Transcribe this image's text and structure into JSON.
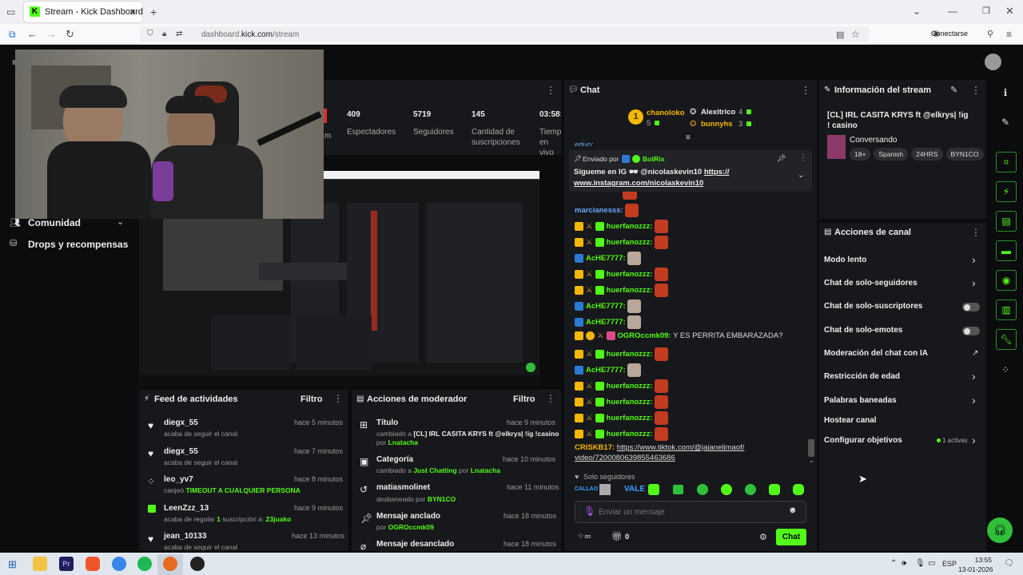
{
  "browser": {
    "tab_title": "Stream - Kick Dashboard",
    "url_prefix": "dashboard.",
    "url_domain": "kick.com",
    "url_path": "/stream",
    "connect_label": "Conectarse"
  },
  "nav": {
    "comunidad": "Comunidad",
    "drops": "Drops y recompensas"
  },
  "stats": [
    {
      "value": "409",
      "label": "Espectadores"
    },
    {
      "value": "5719",
      "label": "Seguidores"
    },
    {
      "value": "145",
      "label": "Cantidad de suscripciones"
    },
    {
      "value": "03:58:",
      "label": "Tiempo en vivo"
    }
  ],
  "stats_partial_label": "m",
  "activity": {
    "title": "Feed de actividades",
    "filter": "Filtro",
    "items": [
      {
        "name": "diegx_55",
        "time": "hace 5 minutos",
        "sub": "acaba de seguir el canal"
      },
      {
        "name": "diegx_55",
        "time": "hace 7 minutos",
        "sub": "acaba de seguir el canal"
      },
      {
        "name": "leo_yv7",
        "time": "hace 8 minutos",
        "sub": "canjeó",
        "highlight": "TIMEOUT A CUALQUIER PERSONA"
      },
      {
        "name": "LeenZzz_13",
        "time": "hace 9 minutos",
        "sub": "acaba de regalar",
        "count": "1",
        "sub2": "suscripción a:",
        "target": "23juako"
      },
      {
        "name": "jean_10133",
        "time": "hace 13 minutos",
        "sub": "acaba de seguir el canal"
      }
    ]
  },
  "mod": {
    "title": "Acciones de moderador",
    "filter": "Filtro",
    "items": [
      {
        "name": "Título",
        "time": "hace 9 minutos",
        "sub": "cambiado a",
        "value": "[CL] IRL CASITA KRYS ft @elkrys| !ig !casino",
        "by": "por",
        "user": "Lnatacha"
      },
      {
        "name": "Categoría",
        "time": "hace 10 minutos",
        "sub": "cambiado a",
        "value": "Just Chatting",
        "by": "por",
        "user": "Lnatacha"
      },
      {
        "name": "matiasmolinet",
        "time": "hace 11 minutos",
        "sub": "desbaneado por",
        "user": "BYN1CO"
      },
      {
        "name": "Mensaje anclado",
        "time": "hace 18 minutos",
        "sub": "por",
        "user": "OGROccmk09"
      },
      {
        "name": "Mensaje desanclado",
        "time": "hace 18 minutos"
      }
    ]
  },
  "chat": {
    "title": "Chat",
    "leaders": [
      {
        "name": "chanoloko",
        "count": "5"
      },
      {
        "name": "Alexitrico",
        "count": "4"
      },
      {
        "name": "bunnyhs",
        "count": "3"
      }
    ],
    "pinned": {
      "sent_by": "Enviado por",
      "author": "BotRix",
      "text": "Sígueme en IG",
      "handle": "@nicolaskevin10",
      "link1": "https://",
      "link2": "www.instagram.com/nicolaskevin10"
    },
    "partial_top": "eduo:",
    "messages": [
      {
        "user": "marcianesss:",
        "color": "#6ea8ff"
      },
      {
        "user": "huerfanozzz:",
        "color": "#53fc18"
      },
      {
        "user": "huerfanozzz:",
        "color": "#53fc18"
      },
      {
        "user": "AcHE7777:",
        "color": "#53fc18"
      },
      {
        "user": "huerfanozzz:",
        "color": "#53fc18"
      },
      {
        "user": "huerfanozzz:",
        "color": "#53fc18"
      },
      {
        "user": "AcHE7777:",
        "color": "#53fc18"
      },
      {
        "user": "AcHE7777:",
        "color": "#53fc18"
      },
      {
        "user": "OGROccmk09:",
        "color": "#53fc18",
        "text": "Y ES PERRITA EMBARAZADA?"
      },
      {
        "user": "huerfanozzz:",
        "color": "#53fc18"
      },
      {
        "user": "AcHE7777:",
        "color": "#53fc18"
      },
      {
        "user": "huerfanozzz:",
        "color": "#53fc18"
      },
      {
        "user": "huerfanozzz:",
        "color": "#53fc18"
      },
      {
        "user": "huerfanozzz:",
        "color": "#53fc18"
      },
      {
        "user": "huerfanozzz:",
        "color": "#53fc18"
      }
    ],
    "link_msg": {
      "user": "CRISKB17:",
      "line1": "https://www.tiktok.com/@jaianelimaof/",
      "line2": "video/7200080639855463686"
    },
    "followers_only": "Solo seguidores",
    "input_placeholder": "Enviar un mensaje",
    "points": "0",
    "send": "Chat"
  },
  "info": {
    "title": "Información del stream",
    "stream_title": "[CL] IRL CASITA KRYS ft @elkrys| !ig ! casino",
    "category": "Conversando",
    "tags": [
      "18+",
      "Spanish",
      "24HRS",
      "BYN1CO"
    ]
  },
  "actions": {
    "title": "Acciones de canal",
    "items": [
      {
        "label": "Modo lento",
        "control": "chevron"
      },
      {
        "label": "Chat de solo-seguidores",
        "control": "chevron"
      },
      {
        "label": "Chat de solo-suscriptores",
        "control": "toggle"
      },
      {
        "label": "Chat de solo-emotes",
        "control": "toggle"
      },
      {
        "label": "Moderación del chat con IA",
        "control": "external"
      },
      {
        "label": "Restricción de edad",
        "control": "chevron"
      },
      {
        "label": "Palabras baneadas",
        "control": "chevron"
      },
      {
        "label": "Hostear canal",
        "control": "none"
      },
      {
        "label": "Configurar objetivos",
        "control": "chevron",
        "extra": "1 activas"
      }
    ]
  },
  "taskbar": {
    "lang": "ESP",
    "time": "13:55",
    "date": "13-01-2026"
  },
  "colors": {
    "accent": "#53fc18",
    "panel": "#17181b",
    "background": "#0b0c0d"
  }
}
